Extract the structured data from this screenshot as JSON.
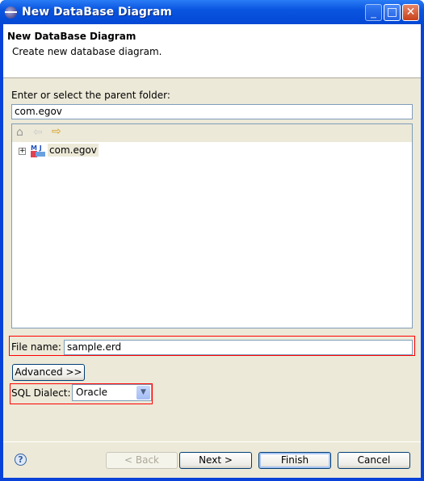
{
  "window": {
    "title": "New DataBase Diagram",
    "minimize": "_",
    "maximize": "□",
    "close": "✕"
  },
  "header": {
    "title": "New DataBase Diagram",
    "description": "Create new database diagram."
  },
  "folder": {
    "label": "Enter or select the parent folder:",
    "value": "com.egov",
    "toolbar": {
      "home": "home-icon",
      "back": "back-arrow-icon",
      "forward": "forward-arrow-icon"
    },
    "tree": [
      {
        "label": "com.egov",
        "expanded": false
      }
    ]
  },
  "file": {
    "label": "File name:",
    "value": "sample.erd"
  },
  "advanced": {
    "label": "Advanced >>"
  },
  "dialect": {
    "label": "SQL Dialect:",
    "value": "Oracle"
  },
  "buttons": {
    "back": "< Back",
    "next": "Next >",
    "finish": "Finish",
    "cancel": "Cancel",
    "back_enabled": false
  },
  "highlight_color": "#ff0000"
}
